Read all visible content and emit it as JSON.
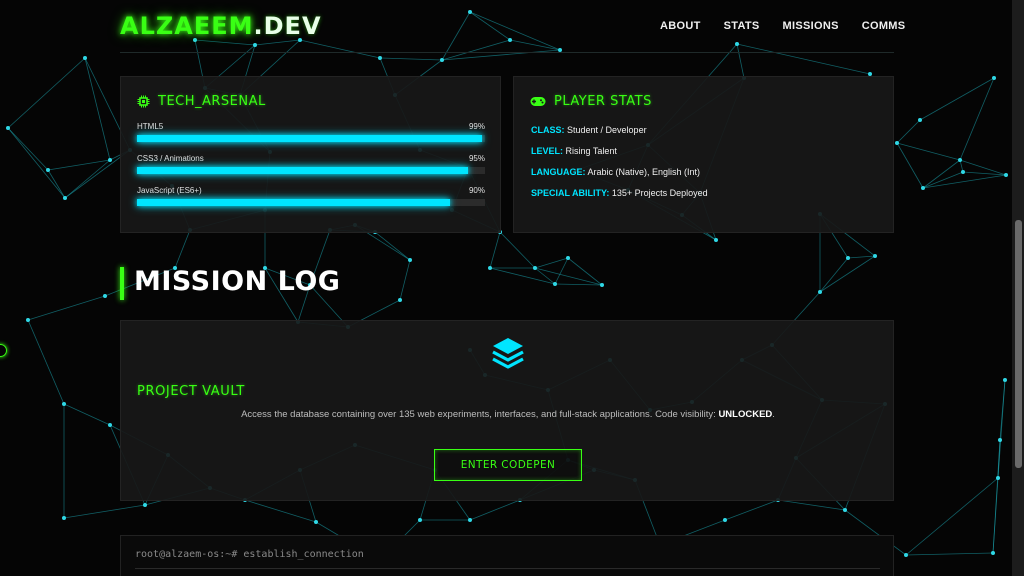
{
  "header": {
    "logo_main": "ALZAEEM",
    "logo_suffix": ".DEV",
    "nav": [
      "ABOUT",
      "STATS",
      "MISSIONS",
      "COMMS"
    ]
  },
  "arsenal": {
    "title": "TECH_ARSENAL",
    "icon": "chip-icon",
    "skills": [
      {
        "name": "HTML5",
        "percent_label": "99%",
        "level": 0.99
      },
      {
        "name": "CSS3 / Animations",
        "percent_label": "95%",
        "level": 0.95
      },
      {
        "name": "JavaScript (ES6+)",
        "percent_label": "90%",
        "level": 0.9
      }
    ]
  },
  "stats": {
    "title": "PLAYER STATS",
    "icon": "gamepad-icon",
    "items": [
      {
        "key": "CLASS:",
        "value": "Student / Developer"
      },
      {
        "key": "LEVEL:",
        "value": "Rising Talent"
      },
      {
        "key": "LANGUAGE:",
        "value": "Arabic (Native), English (Int)"
      },
      {
        "key": "SPECIAL ABILITY:",
        "value": "135+ Projects Deployed"
      }
    ]
  },
  "missions": {
    "heading": "MISSION LOG",
    "vault_icon": "layers-icon",
    "vault_title": "PROJECT VAULT",
    "vault_desc": "Access the database containing over 135 web experiments, interfaces, and full-stack applications. Code visibility: ",
    "vault_desc_strong": "UNLOCKED",
    "vault_desc_end": ".",
    "button": "ENTER CODEPEN"
  },
  "terminal": {
    "command": "root@alzaem-os:~# establish_connection"
  },
  "colors": {
    "accent_green": "#39ff14",
    "accent_cyan": "#00e5ff",
    "background": "#050505"
  }
}
